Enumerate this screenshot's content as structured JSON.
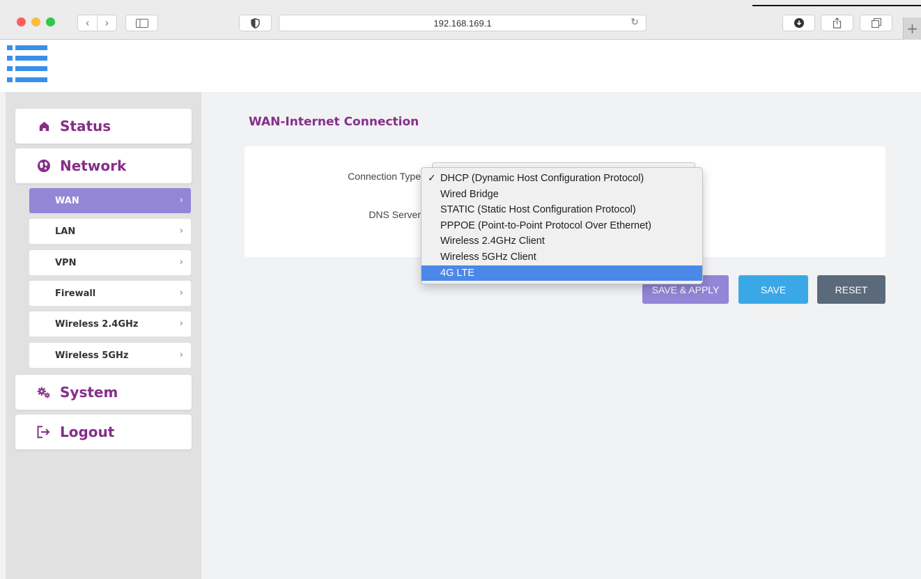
{
  "browser": {
    "url": "192.168.169.1",
    "back_glyph": "‹",
    "forward_glyph": "›",
    "reload_glyph": "↻",
    "new_tab_glyph": "+"
  },
  "colors": {
    "brand_purple": "#862e8a",
    "active_menu": "#9386d6",
    "save_blue": "#3aa8e6",
    "reset_slate": "#5b6a7a",
    "dropdown_highlight": "#4b88e8",
    "logo_blue": "#3a8fe8"
  },
  "sidebar": {
    "main_items": [
      {
        "label": "Status",
        "icon": "home-icon"
      },
      {
        "label": "Network",
        "icon": "globe-icon"
      },
      {
        "label": "System",
        "icon": "gears-icon"
      },
      {
        "label": "Logout",
        "icon": "logout-icon"
      }
    ],
    "network_subitems": [
      {
        "label": "WAN",
        "active": true
      },
      {
        "label": "LAN",
        "active": false
      },
      {
        "label": "VPN",
        "active": false
      },
      {
        "label": "Firewall",
        "active": false
      },
      {
        "label": "Wireless 2.4GHz",
        "active": false
      },
      {
        "label": "Wireless 5GHz",
        "active": false
      }
    ],
    "chevron": "›"
  },
  "main": {
    "title": "WAN-Internet Connection",
    "fields": [
      {
        "label": "Connection Type"
      },
      {
        "label": "DNS Server"
      }
    ],
    "buttons": {
      "save_apply": "SAVE & APPLY",
      "save": "SAVE",
      "reset": "RESET"
    }
  },
  "dropdown": {
    "checkmark": "✓",
    "selected": "DHCP (Dynamic Host Configuration Protocol)",
    "highlighted": "4G LTE",
    "options": [
      "DHCP (Dynamic Host Configuration Protocol)",
      "Wired Bridge",
      "STATIC (Static Host Configuration Protocol)",
      "PPPOE (Point-to-Point Protocol Over Ethernet)",
      "Wireless 2.4GHz Client",
      "Wireless 5GHz Client",
      "4G LTE"
    ]
  }
}
